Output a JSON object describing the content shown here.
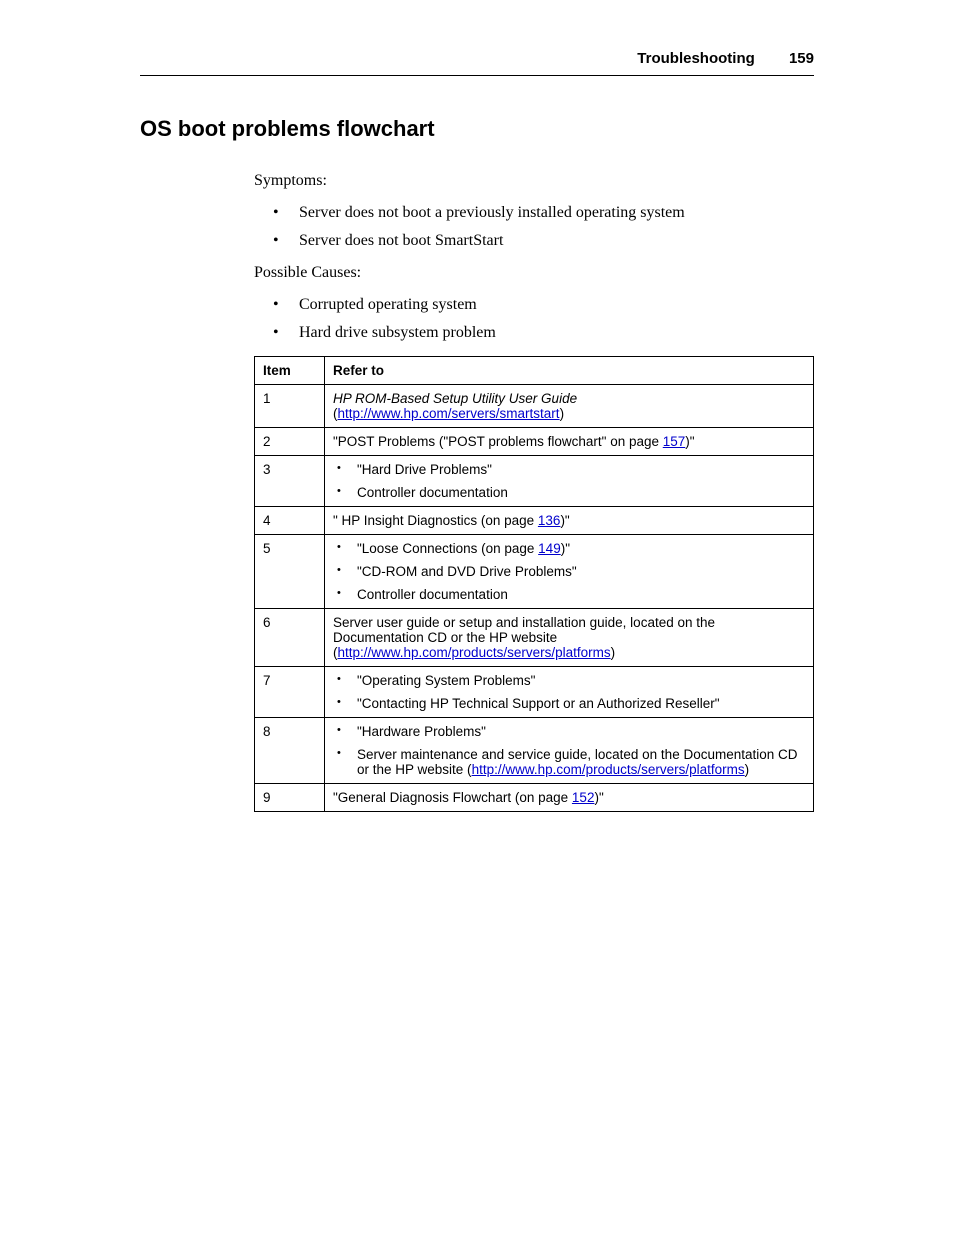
{
  "header": {
    "section": "Troubleshooting",
    "page": "159"
  },
  "heading": "OS boot problems flowchart",
  "symptoms": {
    "label": "Symptoms:",
    "items": [
      "Server does not boot a previously installed operating system",
      "Server does not boot SmartStart"
    ]
  },
  "causes": {
    "label": "Possible Causes:",
    "items": [
      "Corrupted operating system",
      "Hard drive subsystem problem"
    ]
  },
  "table": {
    "headers": {
      "item": "Item",
      "refer": "Refer to"
    },
    "rows": [
      {
        "num": "1",
        "parts": {
          "italic": "HP ROM-Based Setup Utility User Guide",
          "open": " (",
          "link": "http://www.hp.com/servers/smartstart",
          "close": ")"
        }
      },
      {
        "num": "2",
        "parts": {
          "pre": "\"POST Problems (\"POST problems flowchart\" on page ",
          "link": "157",
          "post": ")\""
        }
      },
      {
        "num": "3",
        "sub": [
          {
            "text": "\"Hard Drive Problems\""
          },
          {
            "text": "Controller documentation"
          }
        ]
      },
      {
        "num": "4",
        "parts": {
          "pre": "\" HP Insight Diagnostics (on page ",
          "link": "136",
          "post": ")\""
        }
      },
      {
        "num": "5",
        "sub": [
          {
            "pre": "\"Loose Connections (on page ",
            "link": "149",
            "post": ")\""
          },
          {
            "text": "\"CD-ROM and DVD Drive Problems\""
          },
          {
            "text": "Controller documentation"
          }
        ]
      },
      {
        "num": "6",
        "parts": {
          "pre": "Server user guide or setup and installation guide, located on the Documentation CD or the HP website (",
          "link": "http://www.hp.com/products/servers/platforms",
          "post": ")"
        }
      },
      {
        "num": "7",
        "sub": [
          {
            "text": "\"Operating System Problems\""
          },
          {
            "text": "\"Contacting HP Technical Support or an Authorized Reseller\""
          }
        ]
      },
      {
        "num": "8",
        "sub": [
          {
            "text": "\"Hardware Problems\""
          },
          {
            "pretext": "Server maintenance and service guide, located on the Documentation CD or the HP website (",
            "link": "http://www.hp.com/products/servers/platforms",
            "post": ")"
          }
        ]
      },
      {
        "num": "9",
        "parts": {
          "pre": "\"General Diagnosis Flowchart (on page ",
          "link": "152",
          "post": ")\""
        }
      }
    ]
  }
}
